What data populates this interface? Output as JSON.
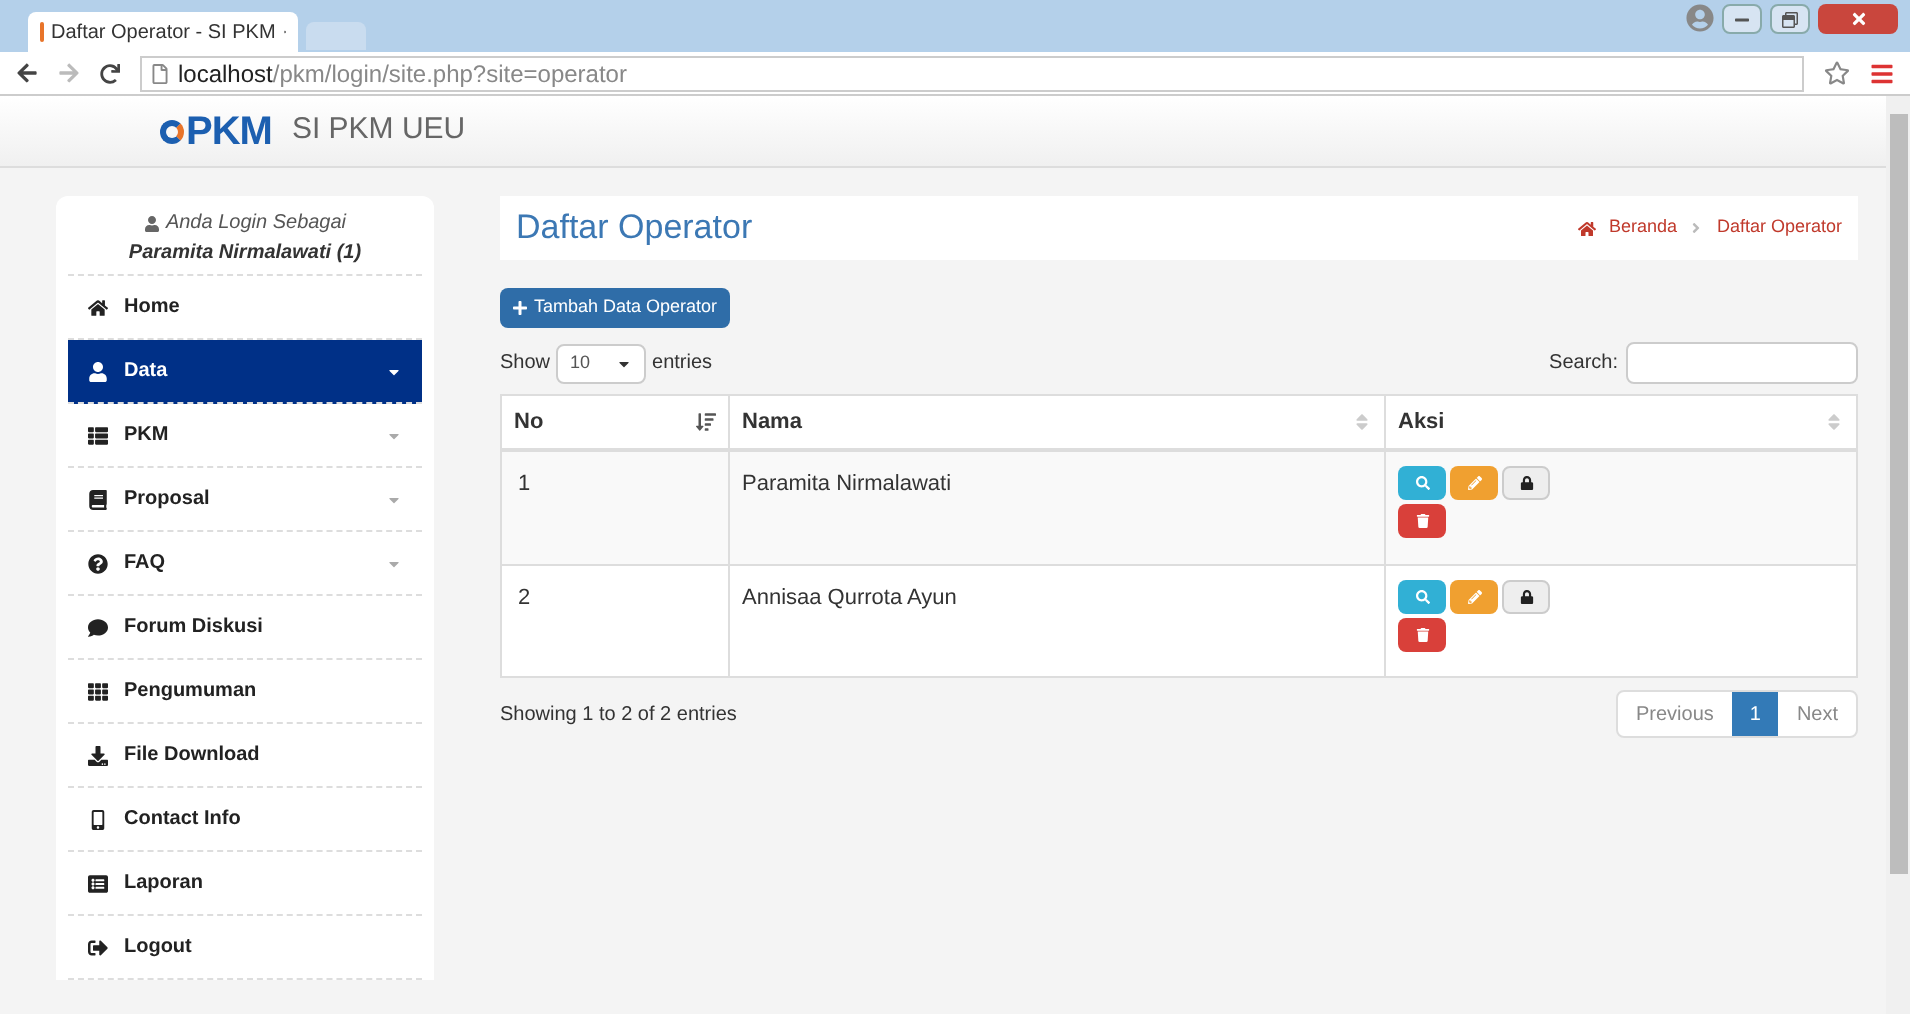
{
  "browser": {
    "tab_title": "Daftar Operator - SI PKM",
    "url_host": "localhost",
    "url_path": "/pkm/login/site.php?site=operator"
  },
  "navbar": {
    "brand": "SI PKM UEU",
    "logo_text": "PKM"
  },
  "sidebar": {
    "login_label": "Anda Login Sebagai",
    "user": "Paramita Nirmalawati (1)",
    "items": [
      {
        "label": "Home",
        "selected": false,
        "kind": "link"
      },
      {
        "label": "Data",
        "selected": true,
        "kind": "dropdown"
      },
      {
        "label": "PKM",
        "selected": false,
        "kind": "dropdown"
      },
      {
        "label": "Proposal",
        "selected": false,
        "kind": "dropdown"
      },
      {
        "label": "FAQ",
        "selected": false,
        "kind": "dropdown"
      },
      {
        "label": "Forum Diskusi",
        "selected": false,
        "kind": "link"
      },
      {
        "label": "Pengumuman",
        "selected": false,
        "kind": "link"
      },
      {
        "label": "File Download",
        "selected": false,
        "kind": "link"
      },
      {
        "label": "Contact Info",
        "selected": false,
        "kind": "link"
      },
      {
        "label": "Laporan",
        "selected": false,
        "kind": "link"
      },
      {
        "label": "Logout",
        "selected": false,
        "kind": "link"
      }
    ]
  },
  "page": {
    "title": "Daftar Operator",
    "breadcrumb": [
      "Beranda",
      "Daftar Operator"
    ]
  },
  "add_button": "Tambah Data Operator",
  "length": {
    "show": "Show",
    "value": "10",
    "entries": "entries"
  },
  "search": {
    "label": "Search:"
  },
  "table": {
    "columns": [
      {
        "label": "No",
        "sorted": true
      },
      {
        "label": "Nama",
        "sorted": false
      },
      {
        "label": "Aksi",
        "sorted": false
      }
    ],
    "rows": [
      {
        "no": "1",
        "nama": "Paramita Nirmalawati"
      },
      {
        "no": "2",
        "nama": "Annisaa Qurrota Ayun"
      }
    ]
  },
  "info": "Showing 1 to 2 of 2 entries",
  "pagination": [
    {
      "label": "Previous",
      "selected": false
    },
    {
      "label": "1",
      "selected": true
    },
    {
      "label": "Next",
      "selected": false
    }
  ]
}
